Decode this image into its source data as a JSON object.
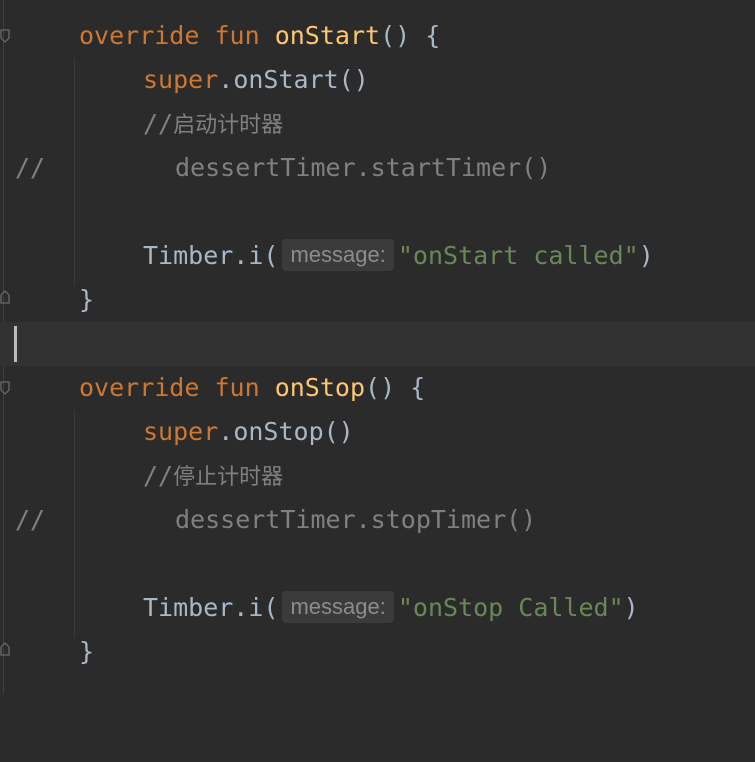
{
  "lines": {
    "l1": {
      "kw1": "override",
      "kw2": "fun",
      "fn": "onStart",
      "rest": "() {"
    },
    "l2": {
      "kw": "super",
      "rest": ".onStart()"
    },
    "l3": {
      "comment": "//",
      "cjk": "启动计时器"
    },
    "l4": {
      "prefix": "//",
      "code": "dessertTimer.startTimer()"
    },
    "l6": {
      "call": "Timber.i(",
      "hint": "message:",
      "str": "\"onStart called\"",
      "close": ")"
    },
    "l7": {
      "brace": "}"
    },
    "l9": {
      "kw1": "override",
      "kw2": "fun",
      "fn": "onStop",
      "rest": "() {"
    },
    "l10": {
      "kw": "super",
      "rest": ".onStop()"
    },
    "l11": {
      "comment": "//",
      "cjk": "停止计时器"
    },
    "l12": {
      "prefix": "//",
      "code": "dessertTimer.stopTimer()"
    },
    "l14": {
      "call": "Timber.i(",
      "hint": "message:",
      "str": "\"onStop Called\"",
      "close": ")"
    },
    "l15": {
      "brace": "}"
    }
  },
  "colors": {
    "background": "#2b2b2b",
    "keyword": "#cc7832",
    "function": "#ffc66d",
    "comment": "#808080",
    "string": "#6a8759",
    "text": "#a9b7c6",
    "current_line": "#323232"
  }
}
